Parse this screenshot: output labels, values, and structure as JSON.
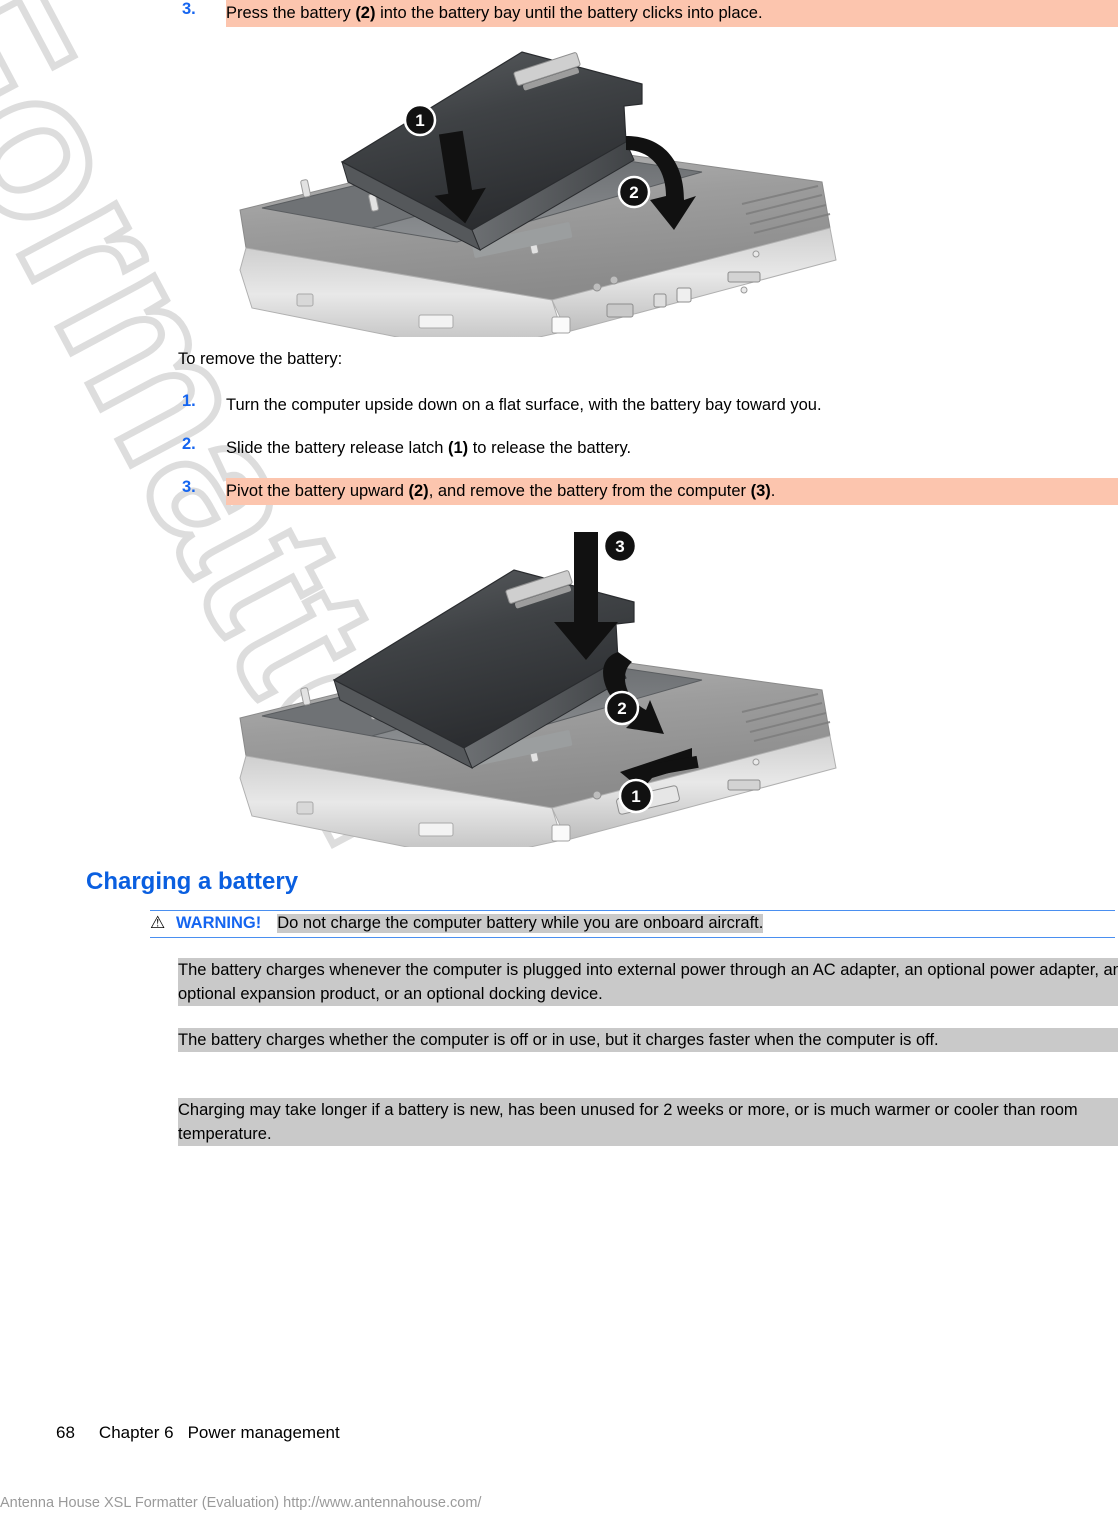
{
  "watermark": {
    "text": "Formatter",
    "color": "#dcdcdc"
  },
  "colors": {
    "accent_blue": "#1565f0",
    "heading_blue": "#0a5fe0",
    "highlight_peach": "#fcc5ae",
    "highlight_gray": "#c9c9c9",
    "rule_blue": "#4a8ff0",
    "eval_gray": "#9a9a9a"
  },
  "insert_steps": [
    {
      "number": "3.",
      "text_parts": [
        {
          "text": "Press the battery ",
          "bold": false
        },
        {
          "text": "(2)",
          "bold": true
        },
        {
          "text": " into the battery bay until the battery clicks into place.",
          "bold": false
        }
      ],
      "highlight": "peach"
    }
  ],
  "figure_insert": {
    "alt": "Laptop underside with battery being pressed into the battery bay",
    "callouts": [
      "1",
      "2"
    ]
  },
  "remove_intro": "To remove the battery:",
  "remove_steps": [
    {
      "number": "1.",
      "text_parts": [
        {
          "text": "Turn the computer upside down on a flat surface, with the battery bay toward you.",
          "bold": false
        }
      ],
      "highlight": "none"
    },
    {
      "number": "2.",
      "text_parts": [
        {
          "text": "Slide the battery release latch ",
          "bold": false
        },
        {
          "text": "(1)",
          "bold": true
        },
        {
          "text": " to release the battery.",
          "bold": false
        }
      ],
      "highlight": "none"
    },
    {
      "number": "3.",
      "text_parts": [
        {
          "text": "Pivot the battery upward ",
          "bold": false
        },
        {
          "text": "(2)",
          "bold": true
        },
        {
          "text": ", and remove the battery from the computer ",
          "bold": false
        },
        {
          "text": "(3)",
          "bold": true
        },
        {
          "text": ".",
          "bold": false
        }
      ],
      "highlight": "peach"
    }
  ],
  "figure_remove": {
    "alt": "Laptop underside with battery being pivoted up and lifted out",
    "callouts": [
      "1",
      "2",
      "3"
    ]
  },
  "section": {
    "heading": "Charging a battery",
    "warning": {
      "icon": "warning-triangle",
      "label": "WARNING!",
      "body": "Do not charge the computer battery while you are onboard aircraft."
    },
    "paragraphs": [
      "The battery charges whenever the computer is plugged into external power through an AC adapter, an optional power adapter, an optional expansion product, or an optional docking device.",
      "The battery charges whether the computer is off or in use, but it charges faster when the computer is off.",
      "Charging may take longer if a battery is new, has been unused for 2 weeks or more, or is much warmer or cooler than room temperature."
    ]
  },
  "footer": {
    "page_number": "68",
    "chapter": "Chapter 6",
    "chapter_title": "Power management"
  },
  "evaluation_notice": "Antenna House XSL Formatter (Evaluation)  http://www.antennahouse.com/"
}
